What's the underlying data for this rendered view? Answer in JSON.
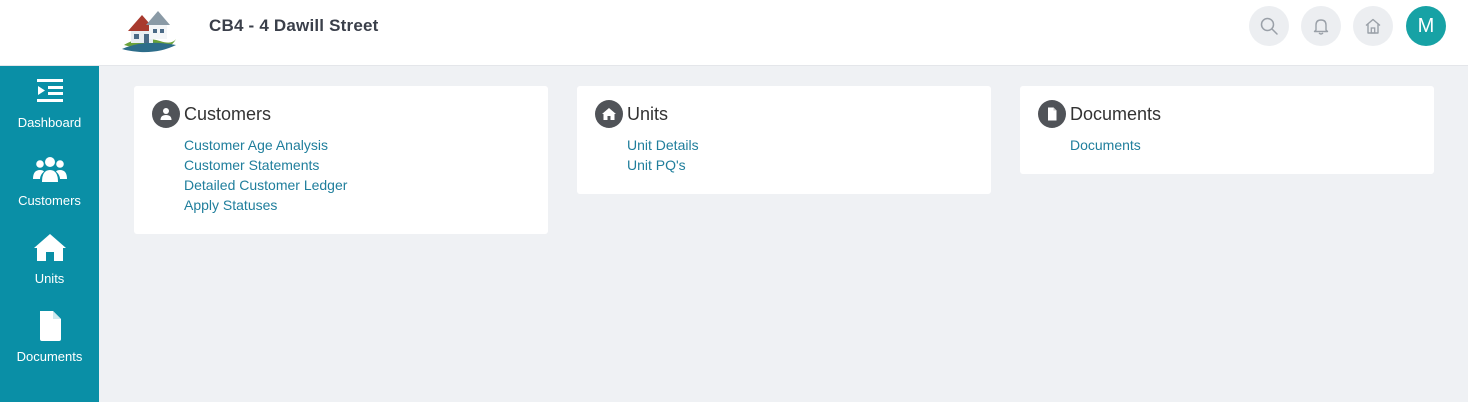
{
  "header": {
    "title": "CB4 - 4 Dawill Street",
    "avatar_initial": "M",
    "actions": [
      {
        "name": "search",
        "icon": "search-icon"
      },
      {
        "name": "notifications",
        "icon": "bell-icon"
      },
      {
        "name": "home",
        "icon": "home-icon"
      }
    ]
  },
  "sidebar": {
    "items": [
      {
        "label": "Dashboard",
        "icon": "dashboard-icon"
      },
      {
        "label": "Customers",
        "icon": "users-icon"
      },
      {
        "label": "Units",
        "icon": "home-icon"
      },
      {
        "label": "Documents",
        "icon": "document-icon"
      }
    ]
  },
  "cards": [
    {
      "title": "Customers",
      "icon": "user-icon",
      "links": [
        "Customer Age Analysis",
        "Customer Statements",
        "Detailed Customer Ledger",
        "Apply Statuses"
      ]
    },
    {
      "title": "Units",
      "icon": "home-icon",
      "links": [
        "Unit Details",
        "Unit PQ's"
      ]
    },
    {
      "title": "Documents",
      "icon": "document-icon",
      "links": [
        "Documents"
      ]
    }
  ],
  "colors": {
    "sidebar": "#0a8fa6",
    "link": "#1f7e9c",
    "avatar": "#17a2a5",
    "background": "#eff1f4"
  }
}
